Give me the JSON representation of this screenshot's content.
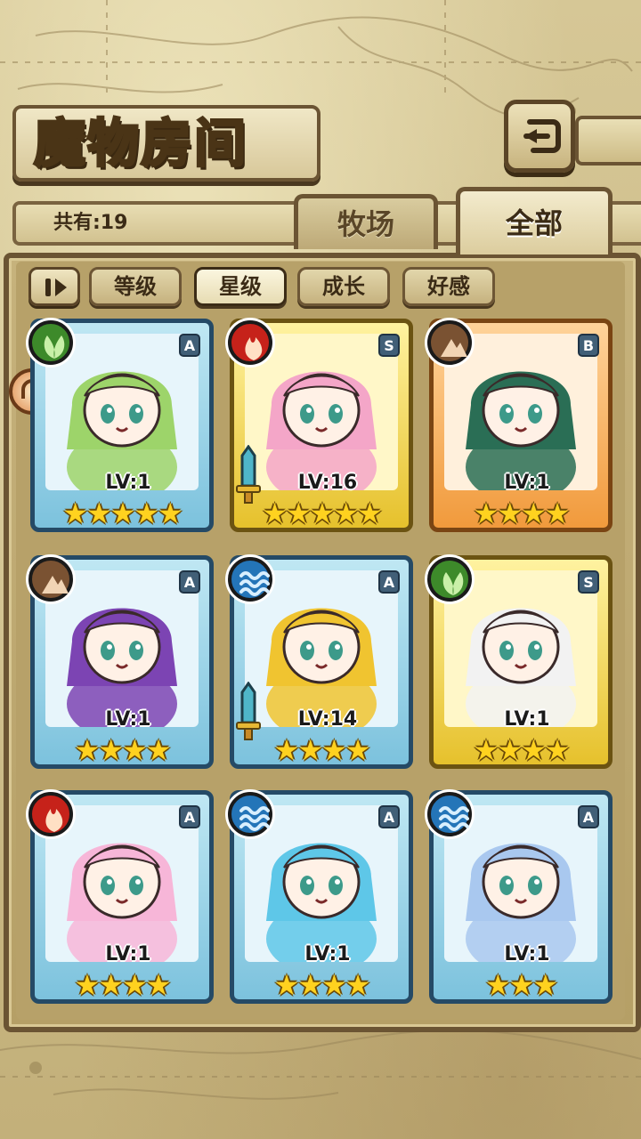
{
  "header": {
    "title": "魔物房间",
    "back_icon": "back-arrow-icon"
  },
  "info": {
    "count_text": "共有:19"
  },
  "tabs": [
    {
      "label": "牧场",
      "active": false
    },
    {
      "label": "全部",
      "active": true
    }
  ],
  "sort": {
    "toggle_icon": "pause-sort-icon",
    "buttons": [
      {
        "label": "等级",
        "active": false
      },
      {
        "label": "星级",
        "active": true
      },
      {
        "label": "成长",
        "active": false
      },
      {
        "label": "好感",
        "active": false
      }
    ]
  },
  "monsters": [
    {
      "element": "grass",
      "rank": "A",
      "level": "LV:1",
      "stars": "★★★★★",
      "frame": "blue",
      "accent": "#9dd46a"
    },
    {
      "element": "fire",
      "rank": "S",
      "level": "LV:16",
      "stars": "★★★★★",
      "frame": "gold",
      "accent": "#f4a6c8"
    },
    {
      "element": "earth",
      "rank": "B",
      "level": "LV:1",
      "stars": "★★★★",
      "frame": "orange",
      "accent": "#2a6e55"
    },
    {
      "element": "earth",
      "rank": "A",
      "level": "LV:1",
      "stars": "★★★★",
      "frame": "blue",
      "accent": "#7c44b3"
    },
    {
      "element": "water",
      "rank": "A",
      "level": "LV:14",
      "stars": "★★★★",
      "frame": "blue",
      "accent": "#f0c430"
    },
    {
      "element": "grass",
      "rank": "S",
      "level": "LV:1",
      "stars": "★★★★",
      "frame": "gold",
      "accent": "#f2f2f2"
    },
    {
      "element": "fire",
      "rank": "A",
      "level": "LV:1",
      "stars": "★★★★",
      "frame": "blue",
      "accent": "#f7b6d8"
    },
    {
      "element": "water",
      "rank": "A",
      "level": "LV:1",
      "stars": "★★★★",
      "frame": "blue",
      "accent": "#5ec7e8"
    },
    {
      "element": "water",
      "rank": "A",
      "level": "LV:1",
      "stars": "★★★",
      "frame": "blue",
      "accent": "#a9c8ef"
    }
  ],
  "colors": {
    "parchment": "#cdbd8c",
    "frame_dark": "#6b5433",
    "star": "#ffd21f"
  }
}
